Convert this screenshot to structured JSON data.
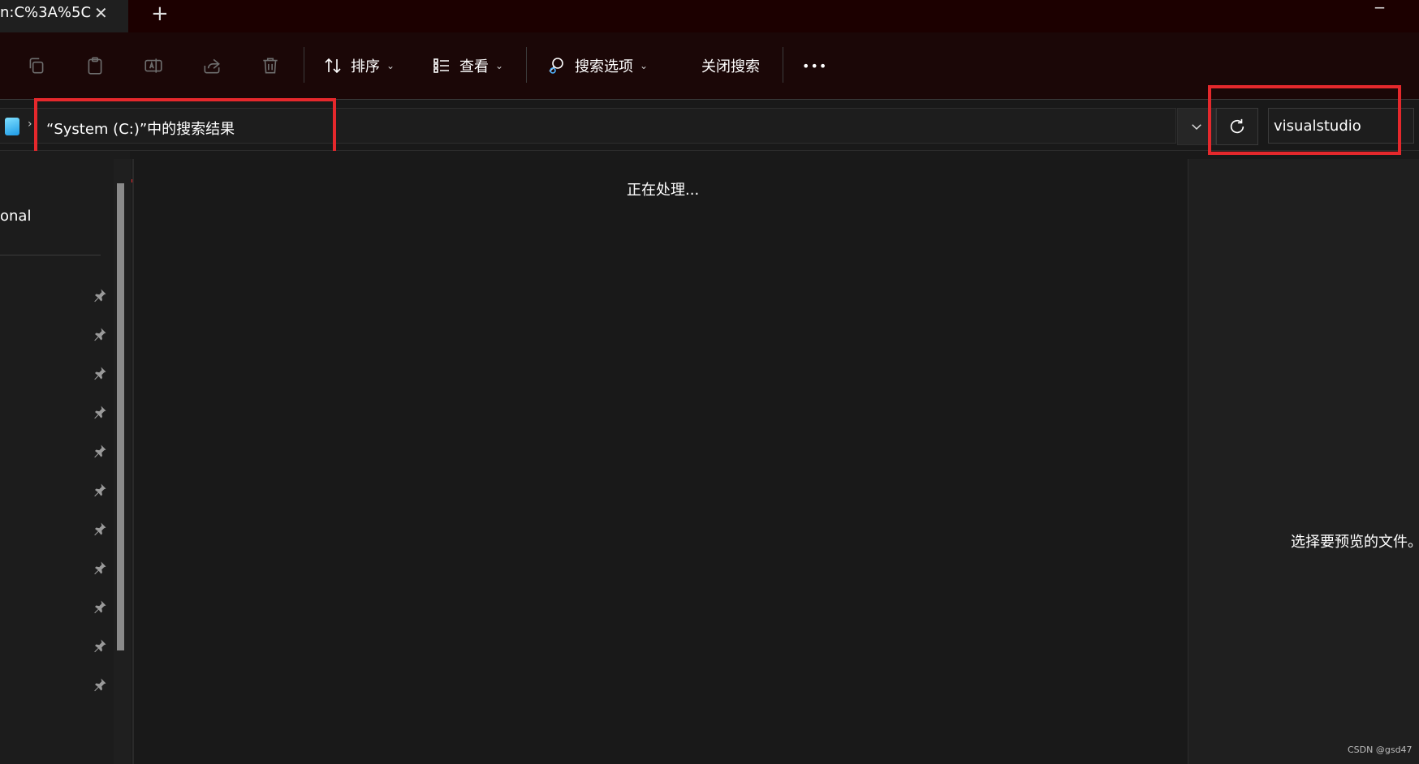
{
  "tab": {
    "title": "n:C%3A%5C",
    "close_glyph": "✕",
    "new_tab_glyph": "+"
  },
  "toolbar": {
    "icons": [
      "copy-icon",
      "paste-icon",
      "rename-icon",
      "share-icon",
      "delete-icon"
    ],
    "sort_label": "排序",
    "view_label": "查看",
    "search_options_label": "搜索选项",
    "close_search_label": "关闭搜索",
    "more_glyph": "•••",
    "caret_glyph": "⌄"
  },
  "address": {
    "chevron": "›",
    "path_text": "“System (C:)”中的搜索结果"
  },
  "search": {
    "value": "visualstudio"
  },
  "sidebar": {
    "item_label": "onal",
    "pinned_count": 11
  },
  "main": {
    "status": "正在处理..."
  },
  "preview": {
    "empty_text": "选择要预览的文件。"
  },
  "watermark": "CSDN @gsd47",
  "colors": {
    "highlight": "#e5282c",
    "tabbar": "#1c0000",
    "background": "#191919"
  }
}
